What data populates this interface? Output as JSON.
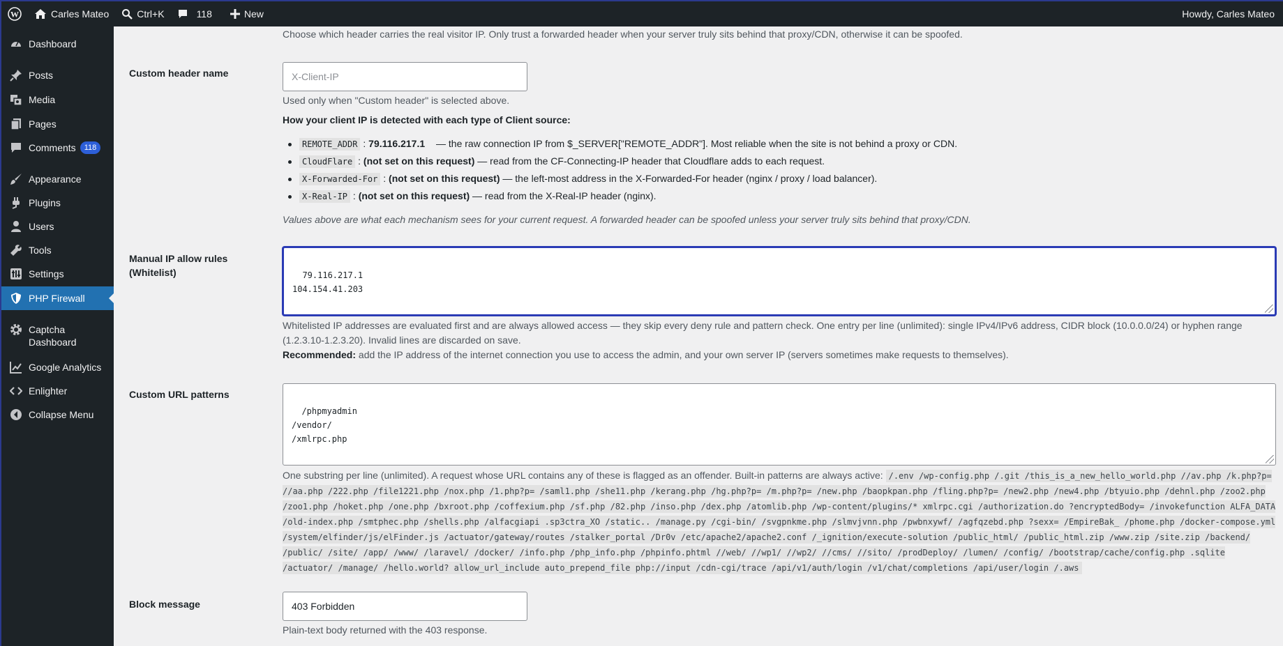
{
  "adminbar": {
    "site_name": "Carles Mateo",
    "search_shortcut": "Ctrl+K",
    "comments_count": "118",
    "new_label": "New",
    "howdy": "Howdy, Carles Mateo"
  },
  "sidebar": {
    "items": [
      {
        "label": "Dashboard",
        "icon": "dashboard-icon"
      },
      {
        "label": "Posts",
        "icon": "pin-icon"
      },
      {
        "label": "Media",
        "icon": "media-icon"
      },
      {
        "label": "Pages",
        "icon": "pages-icon"
      },
      {
        "label": "Comments",
        "icon": "comment-icon",
        "badge": "118"
      },
      {
        "label": "Appearance",
        "icon": "brush-icon"
      },
      {
        "label": "Plugins",
        "icon": "plug-icon"
      },
      {
        "label": "Users",
        "icon": "user-icon"
      },
      {
        "label": "Tools",
        "icon": "wrench-icon"
      },
      {
        "label": "Settings",
        "icon": "settings-icon"
      },
      {
        "label": "PHP Firewall",
        "icon": "shield-icon",
        "active": true
      },
      {
        "label": "Captcha Dashboard",
        "icon": "gear-icon"
      },
      {
        "label": "Google Analytics",
        "icon": "chart-icon"
      },
      {
        "label": "Enlighter",
        "icon": "code-icon"
      },
      {
        "label": "Collapse Menu",
        "icon": "collapse-icon"
      }
    ]
  },
  "main": {
    "top_desc": "Choose which header carries the real visitor IP. Only trust a forwarded header when your server truly sits behind that proxy/CDN, otherwise it can be spoofed.",
    "custom_header": {
      "label": "Custom header name",
      "placeholder": "X-Client-IP",
      "desc": "Used only when \"Custom header\" is selected above."
    },
    "client_ip_heading": "How your client IP is detected with each type of Client source:",
    "client_sources": [
      {
        "code": "REMOTE_ADDR",
        "value": "79.116.217.1",
        "desc": " — the raw connection IP from $_SERVER[\"REMOTE_ADDR\"]. Most reliable when the site is not behind a proxy or CDN."
      },
      {
        "code": "CloudFlare",
        "value": "(not set on this request)",
        "desc": " — read from the CF-Connecting-IP header that Cloudflare adds to each request."
      },
      {
        "code": "X-Forwarded-For",
        "value": "(not set on this request)",
        "desc": " — the left-most address in the X-Forwarded-For header (nginx / proxy / load balancer)."
      },
      {
        "code": "X-Real-IP",
        "value": "(not set on this request)",
        "desc": " — read from the X-Real-IP header (nginx)."
      }
    ],
    "client_ip_note": "Values above are what each mechanism sees for your current request. A forwarded header can be spoofed unless your server truly sits behind that proxy/CDN.",
    "whitelist": {
      "label_line1": "Manual IP allow rules",
      "label_line2": "(Whitelist)",
      "value": "79.116.217.1\n104.154.41.203",
      "desc_line1": "Whitelisted IP addresses are evaluated first and are always allowed access — they skip every deny rule and pattern check. One entry per line (unlimited): single IPv4/IPv6 address, CIDR block (10.0.0.0/24) or hyphen range",
      "desc_line2": "(1.2.3.10-1.2.3.20). Invalid lines are discarded on save.",
      "recommended_label": "Recommended:",
      "recommended_text": " add the IP address of the internet connection you use to access the admin, and your own server IP (servers sometimes make requests to themselves)."
    },
    "url_patterns": {
      "label": "Custom URL patterns",
      "value": "/phpmyadmin\n/vendor/\n/xmlrpc.php",
      "desc": "One substring per line (unlimited). A request whose URL contains any of these is flagged as an offender. Built-in patterns are always active: ",
      "builtin": "/.env /wp-config.php /.git /this_is_a_new_hello_world.php //av.php /k.php?p= //aa.php /222.php /file1221.php /nox.php /1.php?p= /saml1.php /she11.php /kerang.php /hg.php?p= /m.php?p= /new.php /baopkpan.php /fling.php?p= /new2.php /new4.php /btyuio.php /dehnl.php /zoo2.php /zoo1.php /hoket.php /one.php /bxroot.php /coffexium.php /sf.php /82.php /inso.php /dex.php /atomlib.php /wp-content/plugins/* xmlrpc.cgi /authorization.do ?encryptedBody= /invokefunction ALFA_DATA /old-index.php /smtphec.php /shells.php /alfacgiapi .sp3ctra_XO /static.. /manage.py /cgi-bin/ /svgpnkme.php /slmvjvnn.php /pwbnxywf/ /agfqzebd.php ?sexx= /EmpireBak_ /phome.php /docker-compose.yml /system/elfinder/js/elFinder.js /actuator/gateway/routes /stalker_portal /Dr0v /etc/apache2/apache2.conf /_ignition/execute-solution /public_html/ /public_html.zip /www.zip /site.zip /backend/ /public/ /site/ /app/ /www/ /laravel/ /docker/ /info.php /php_info.php /phpinfo.phtml //web/ //wp1/ //wp2/ //cms/ //sito/ /prodDeploy/ /lumen/ /config/ /bootstrap/cache/config.php .sqlite /actuator/ /manage/ /hello.world? allow_url_include auto_prepend_file php://input /cdn-cgi/trace /api/v1/auth/login /v1/chat/completions /api/user/login /.aws"
    },
    "block_message": {
      "label": "Block message",
      "value": "403 Forbidden",
      "desc": "Plain-text body returned with the 403 response."
    }
  }
}
